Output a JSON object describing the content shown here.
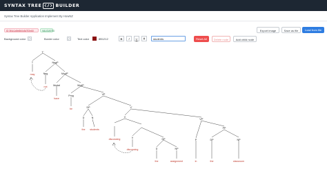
{
  "app": {
    "logo_left": "SYNTAX TREE",
    "logo_mark": "</>",
    "logo_right": "BUILDER",
    "subtitle": "Syntax Tree Builder Application Implement By HowNZ"
  },
  "status": {
    "hash_badge": "ID 3f4c1a9e8b0c5d7f2e60",
    "valid_badge": "VALIDATED"
  },
  "toolbar": {
    "export_label": "Export image",
    "save_label": "Save as file",
    "load_label": "Load from file",
    "bg_color_label": "Background color",
    "border_color_label": "Border color",
    "text_color_label": "Text color",
    "text_color_hex": "8B1212",
    "bold": "B",
    "italic": "I",
    "underline": "U",
    "strike": "S",
    "node_input_value": "students",
    "reset_label": "Reset All",
    "delete_label": "Delete node",
    "add_child_label": "Add child node"
  },
  "colors": {
    "header_bg": "#1d2733",
    "accent_blue": "#2f7de1",
    "danger": "#ee4d4d",
    "leaf_text": "#c0392b",
    "category_text": "#222222"
  },
  "tree": {
    "nodes": [
      "T'",
      "T",
      "NegP",
      "may",
      "Neg",
      "ModP'",
      "not",
      "Modal",
      "ModP",
      "have",
      "Prog",
      "VP",
      "be",
      "DP",
      "V'",
      "D",
      "N",
      "V",
      "VP'",
      "the",
      "students",
      "discussing",
      "V",
      "DP",
      "PP",
      "discussing",
      "D",
      "NP",
      "P",
      "DP",
      "the",
      "assignment",
      "in",
      "D",
      "NP",
      "the",
      "classroom"
    ]
  }
}
